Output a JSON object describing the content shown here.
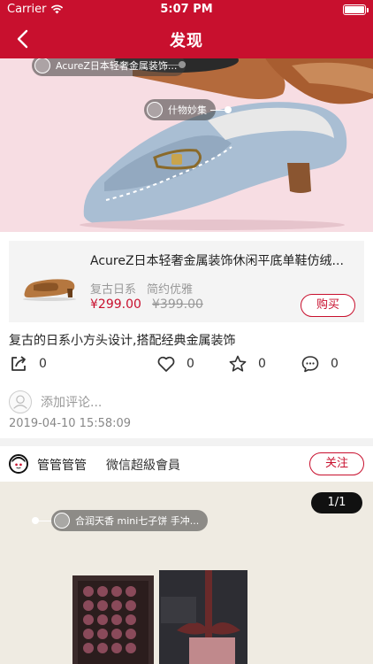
{
  "status_bar": {
    "carrier": "Carrier",
    "time": "5:07 PM"
  },
  "nav": {
    "title": "发现"
  },
  "hero": {
    "tags": [
      {
        "label": "AcureZ日本轻奢金属装饰..."
      },
      {
        "label": "什物妙集"
      }
    ]
  },
  "product": {
    "name": "AcureZ日本轻奢金属装饰休闲平底单鞋仿绒...",
    "tags": [
      "复古日系",
      "简约优雅"
    ],
    "price": "¥299.00",
    "original_price": "¥399.00",
    "buy_label": "购买"
  },
  "post": {
    "description": "复古的日系小方头设计,搭配经典金属装饰",
    "share_count": "0",
    "like_count": "0",
    "favorite_count": "0",
    "comment_count": "0",
    "comment_placeholder": "添加评论...",
    "timestamp": "2019-04-10 15:58:09"
  },
  "author": {
    "name": "管管管管",
    "level": "微信超級會員",
    "follow_label": "关注"
  },
  "post2": {
    "counter": "1/1",
    "tags": [
      {
        "label": "合润天香 mini七子饼 手冲..."
      }
    ]
  },
  "colors": {
    "brand_red": "#c8102e",
    "hero_bg": "#f7dde3",
    "card_bg": "#f4f4f4"
  }
}
